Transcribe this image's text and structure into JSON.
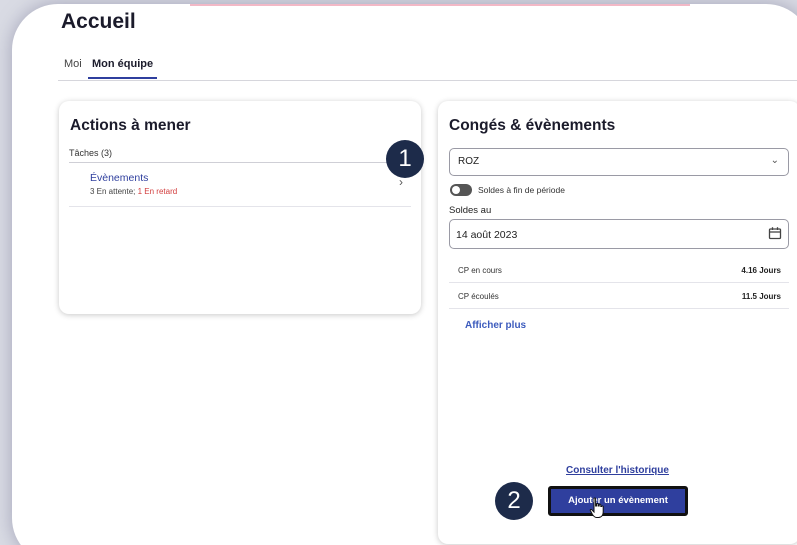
{
  "page": {
    "title": "Accueil"
  },
  "tabs": [
    {
      "label": "Moi",
      "active": false
    },
    {
      "label": "Mon équipe",
      "active": true
    }
  ],
  "actions": {
    "title": "Actions à mener",
    "tasks_header": "Tâches (3)",
    "items": [
      {
        "title": "Évènements",
        "pending": "3 En attente;",
        "late": "1 En retard"
      }
    ]
  },
  "conges": {
    "title": "Congés & évènements",
    "employee_select": {
      "value": "ROZ"
    },
    "toggle": {
      "label": "Soldes à fin de période",
      "on": false
    },
    "soldes_label": "Soldes au",
    "date": {
      "value": "14 août 2023"
    },
    "balances": [
      {
        "label": "CP en cours",
        "value": "4.16 Jours"
      },
      {
        "label": "CP écoulés",
        "value": "11.5 Jours"
      }
    ],
    "show_more": "Afficher plus",
    "history_link": "Consulter l'historique",
    "add_button": "Ajouter un évènement"
  },
  "annotations": {
    "step1": "1",
    "step2": "2"
  },
  "colors": {
    "primary": "#2f3f9e",
    "late": "#d23c3c",
    "badge": "#1d2b4a"
  },
  "icons": {
    "calendar": "calendar-icon",
    "chevron_right": "chevron-right-icon",
    "chevron_down": "chevron-down-icon",
    "cursor": "hand-cursor-icon"
  }
}
